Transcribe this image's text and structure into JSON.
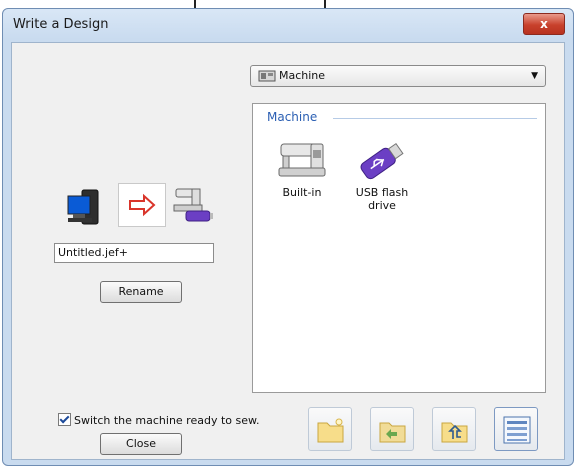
{
  "window": {
    "title": "Write a Design",
    "close_glyph": "x"
  },
  "target_select": {
    "value": "Machine",
    "icon": "machine-icon"
  },
  "machine_panel": {
    "header": "Machine",
    "destinations": [
      {
        "label": "Built-in",
        "icon": "sewing-machine-icon"
      },
      {
        "label": "USB flash drive",
        "icon": "usb-flash-drive-icon"
      }
    ]
  },
  "transfer": {
    "source_icon": "computer-icon",
    "direction_icon": "arrow-right-icon",
    "target_icon": "machine-usb-icon"
  },
  "file": {
    "name": "Untitled.jef+"
  },
  "buttons": {
    "rename": "Rename",
    "close": "Close"
  },
  "switch_option": {
    "label": "Switch the machine ready to sew.",
    "checked": true
  },
  "toolbar": [
    "new-folder-icon",
    "folder-back-icon",
    "folder-up-icon",
    "list-view-icon"
  ],
  "colors": {
    "accent": "#2b5fb3",
    "close_button": "#c8412c",
    "window_frame": "#c9dbef"
  }
}
